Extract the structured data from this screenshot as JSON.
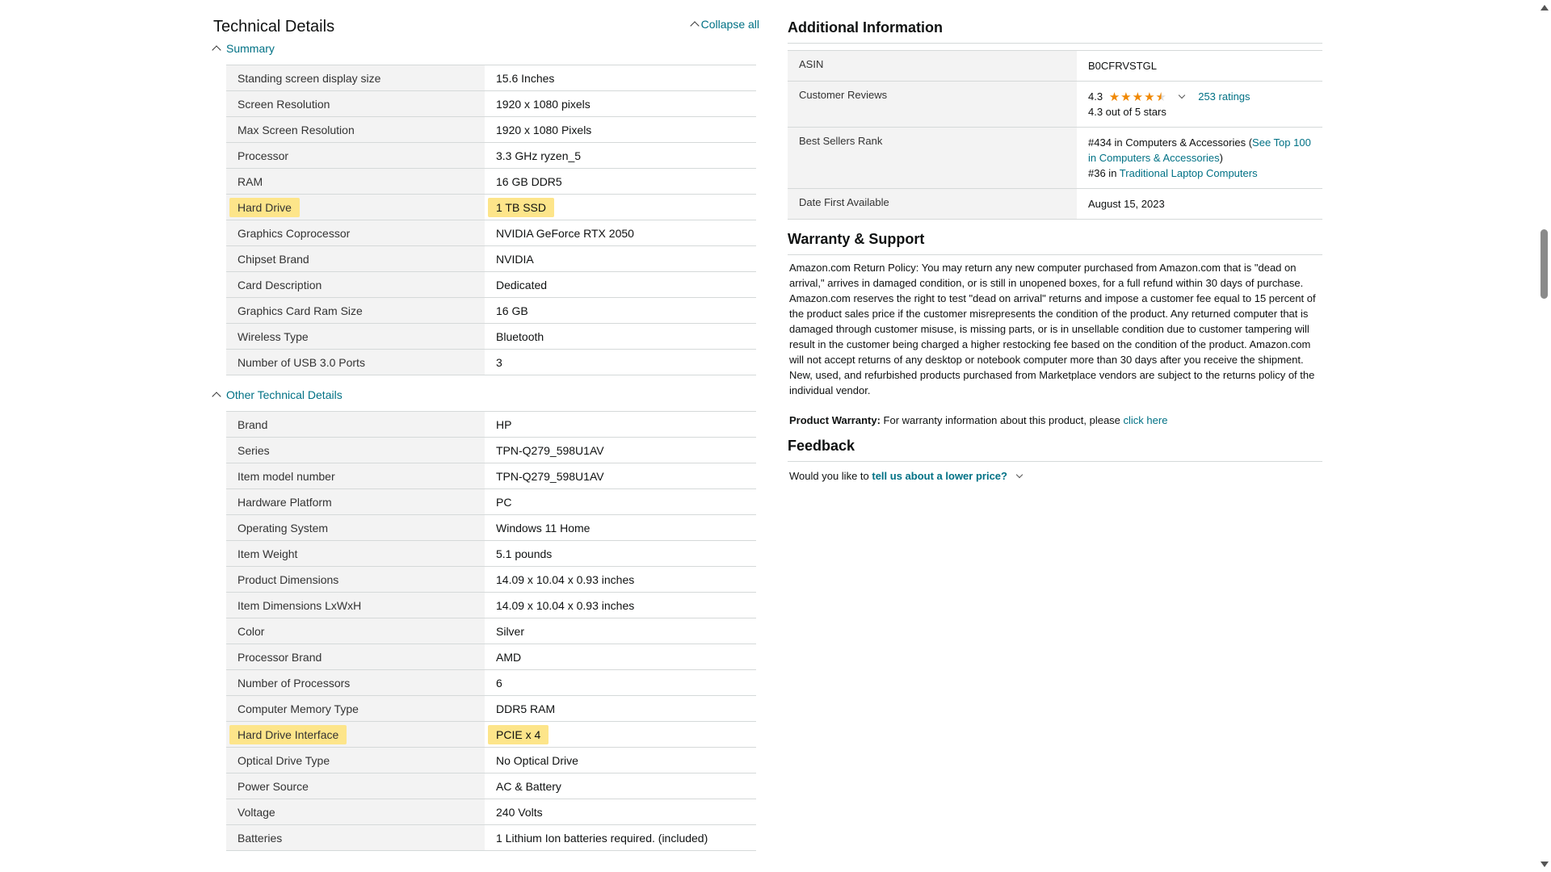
{
  "technical_details": {
    "title": "Technical Details",
    "collapse_all": "Collapse all",
    "summary": {
      "label": "Summary",
      "rows": [
        {
          "key": "Standing screen display size",
          "value": "15.6 Inches"
        },
        {
          "key": "Screen Resolution",
          "value": "1920 x 1080 pixels"
        },
        {
          "key": "Max Screen Resolution",
          "value": "1920 x 1080 Pixels"
        },
        {
          "key": "Processor",
          "value": "3.3 GHz ryzen_5"
        },
        {
          "key": "RAM",
          "value": "16 GB DDR5"
        },
        {
          "key": "Hard Drive",
          "value": "1 TB SSD",
          "highlighted": true
        },
        {
          "key": "Graphics Coprocessor",
          "value": "NVIDIA GeForce RTX 2050"
        },
        {
          "key": "Chipset Brand",
          "value": "NVIDIA"
        },
        {
          "key": "Card Description",
          "value": "Dedicated"
        },
        {
          "key": "Graphics Card Ram Size",
          "value": "16 GB"
        },
        {
          "key": "Wireless Type",
          "value": "Bluetooth"
        },
        {
          "key": "Number of USB 3.0 Ports",
          "value": "3"
        }
      ]
    },
    "other": {
      "label": "Other Technical Details",
      "rows": [
        {
          "key": "Brand",
          "value": "HP"
        },
        {
          "key": "Series",
          "value": "TPN-Q279_598U1AV"
        },
        {
          "key": "Item model number",
          "value": "TPN-Q279_598U1AV"
        },
        {
          "key": "Hardware Platform",
          "value": "PC"
        },
        {
          "key": "Operating System",
          "value": "Windows 11 Home"
        },
        {
          "key": "Item Weight",
          "value": "5.1 pounds"
        },
        {
          "key": "Product Dimensions",
          "value": "14.09 x 10.04 x 0.93 inches"
        },
        {
          "key": "Item Dimensions LxWxH",
          "value": "14.09 x 10.04 x 0.93 inches"
        },
        {
          "key": "Color",
          "value": "Silver"
        },
        {
          "key": "Processor Brand",
          "value": "AMD"
        },
        {
          "key": "Number of Processors",
          "value": "6"
        },
        {
          "key": "Computer Memory Type",
          "value": "DDR5 RAM"
        },
        {
          "key": "Hard Drive Interface",
          "value": "PCIE x 4",
          "highlighted": true
        },
        {
          "key": "Optical Drive Type",
          "value": "No Optical Drive"
        },
        {
          "key": "Power Source",
          "value": "AC & Battery"
        },
        {
          "key": "Voltage",
          "value": "240 Volts"
        },
        {
          "key": "Batteries",
          "value": "1 Lithium Ion batteries required. (included)"
        }
      ]
    }
  },
  "additional_info": {
    "title": "Additional Information",
    "asin_label": "ASIN",
    "asin_value": "B0CFRVSTGL",
    "reviews_label": "Customer Reviews",
    "rating_value": "4.3",
    "rating_stars": 4.3,
    "ratings_count": "253 ratings",
    "rating_text": "4.3 out of 5 stars",
    "rank_label": "Best Sellers Rank",
    "rank1_text": "#434 in Computers & Accessories (",
    "rank1_link": "See Top 100 in Computers & Accessories",
    "rank1_close": ")",
    "rank2_text": "#36 in ",
    "rank2_link": "Traditional Laptop Computers",
    "date_label": "Date First Available",
    "date_value": "August 15, 2023"
  },
  "warranty": {
    "title": "Warranty & Support",
    "policy": "Amazon.com Return Policy: You may return any new computer purchased from Amazon.com that is \"dead on arrival,\" arrives in damaged condition, or is still in unopened boxes, for a full refund within 30 days of purchase. Amazon.com reserves the right to test \"dead on arrival\" returns and impose a customer fee equal to 15 percent of the product sales price if the customer misrepresents the condition of the product. Any returned computer that is damaged through customer misuse, is missing parts, or is in unsellable condition due to customer tampering will result in the customer being charged a higher restocking fee based on the condition of the product. Amazon.com will not accept returns of any desktop or notebook computer more than 30 days after you receive the shipment. New, used, and refurbished products purchased from Marketplace vendors are subject to the returns policy of the individual vendor.",
    "warranty_label": "Product Warranty:",
    "warranty_text": " For warranty information about this product, please ",
    "warranty_link": "click here"
  },
  "feedback": {
    "title": "Feedback",
    "prompt": "Would you like to ",
    "link": "tell us about a lower price?"
  },
  "colors": {
    "link": "#007185",
    "highlight": "#fde58a",
    "key_bg": "#f3f3f3",
    "star": "#f08804"
  }
}
